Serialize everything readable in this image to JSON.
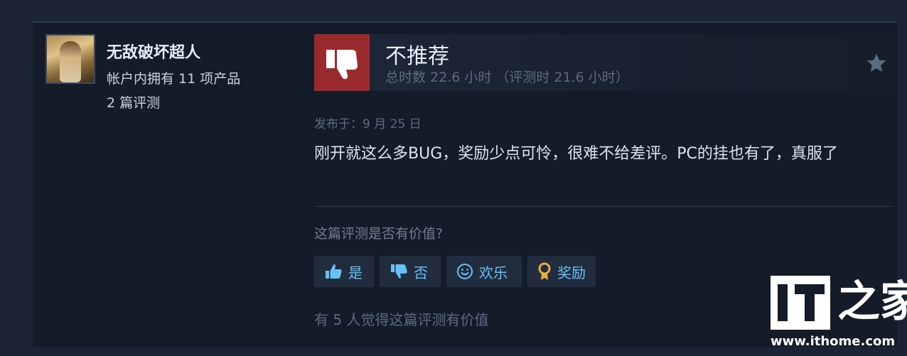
{
  "author": {
    "name": "无敌破坏超人",
    "products_owned": "帐户内拥有 11 项产品",
    "reviews_count": "2 篇评测"
  },
  "verdict": {
    "title": "不推荐",
    "hours": "总时数 22.6 小时 （评测时 21.6 小时）",
    "icon": "thumbs-down-icon",
    "color": "#9b2a2e"
  },
  "review": {
    "posted": "发布于：9 月 25 日",
    "body": "刚开就这么多BUG，奖励少点可怜，很难不给差评。PC的挂也有了，真服了"
  },
  "helpful": {
    "question": "这篇评测是否有价值?",
    "buttons": {
      "yes": "是",
      "no": "否",
      "funny": "欢乐",
      "award": "奖励"
    },
    "count_text": "有 5 人觉得这篇评测有价值"
  },
  "watermark": {
    "logo_text": "IT之家",
    "url": "www.ithome.com"
  },
  "colors": {
    "accent": "#67c1f5",
    "negative": "#9b2a2e",
    "background": "#1b2434"
  }
}
